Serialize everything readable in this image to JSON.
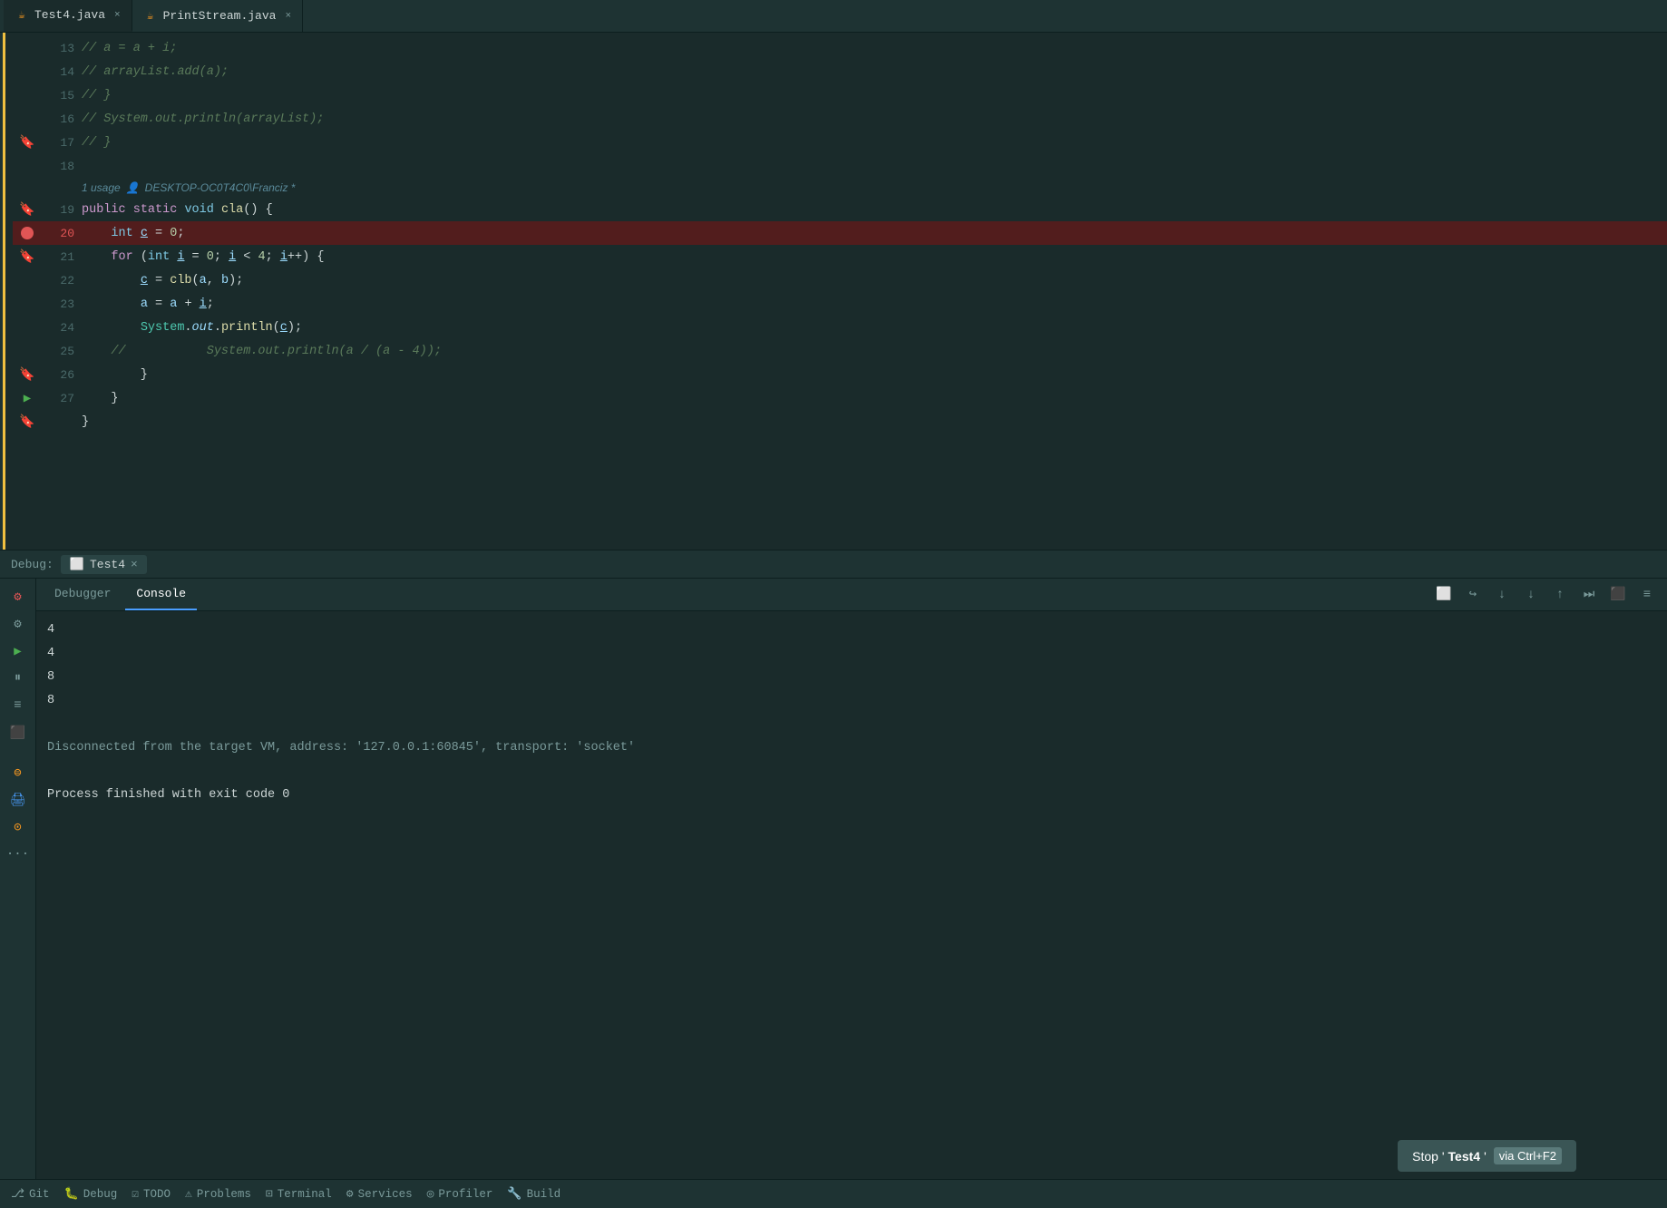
{
  "tabs": [
    {
      "id": "test4",
      "label": "Test4.java",
      "icon": "☕",
      "active": true,
      "closable": true
    },
    {
      "id": "printstream",
      "label": "PrintStream.java",
      "icon": "☕",
      "active": false,
      "closable": true
    }
  ],
  "editor": {
    "lines": [
      {
        "num": 13,
        "content": "//        a = a + i;",
        "type": "comment",
        "gutter": ""
      },
      {
        "num": 14,
        "content": "//        arrayList.add(a);",
        "type": "comment",
        "gutter": ""
      },
      {
        "num": 15,
        "content": "//    }",
        "type": "comment",
        "gutter": ""
      },
      {
        "num": 16,
        "content": "//    System.out.println(arrayList);",
        "type": "comment",
        "gutter": ""
      },
      {
        "num": 17,
        "content": "//    }",
        "type": "comment",
        "gutter": "bookmark"
      },
      {
        "num": 18,
        "content": "",
        "type": "empty",
        "gutter": ""
      },
      {
        "num": 18.5,
        "hint": true,
        "hintText": "1 usage",
        "hintUser": "DESKTOP-OC0T4C0\\Franciz *"
      },
      {
        "num": 19,
        "content": "    public static void cla() {",
        "type": "code",
        "gutter": "bookmark"
      },
      {
        "num": 20,
        "content": "        int c = 0;",
        "type": "code",
        "gutter": "breakpoint",
        "breakpoint": true
      },
      {
        "num": 21,
        "content": "        for (int i = 0; i < 4; i++) {",
        "type": "code",
        "gutter": "bookmark"
      },
      {
        "num": 22,
        "content": "            c = clb(a, b);",
        "type": "code",
        "gutter": ""
      },
      {
        "num": 23,
        "content": "            a = a + i;",
        "type": "code",
        "gutter": ""
      },
      {
        "num": 24,
        "content": "            System.out.println(c);",
        "type": "code",
        "gutter": ""
      },
      {
        "num": 25,
        "content": "//              System.out.println(a / (a - 4));",
        "type": "comment",
        "gutter": ""
      },
      {
        "num": 26,
        "content": "        }",
        "type": "code",
        "gutter": "bookmark"
      },
      {
        "num": 27,
        "content": "        }",
        "type": "code",
        "gutter": "run"
      },
      {
        "num": 27.5,
        "end": true,
        "content": "    }",
        "gutter": "bookmark"
      }
    ]
  },
  "debug_bar": {
    "label": "Debug:",
    "tab_label": "Test4",
    "close": "×"
  },
  "debug_panel": {
    "tabs": [
      {
        "id": "debugger",
        "label": "Debugger",
        "active": false
      },
      {
        "id": "console",
        "label": "Console",
        "active": true
      }
    ],
    "toolbar_buttons": [
      "⬜",
      "↪",
      "↓",
      "↓",
      "↑",
      "⏭",
      "⬛",
      "≡"
    ],
    "console_output": [
      {
        "text": "4",
        "type": "number"
      },
      {
        "text": "4",
        "type": "number"
      },
      {
        "text": "8",
        "type": "number"
      },
      {
        "text": "8",
        "type": "number"
      },
      {
        "text": "",
        "type": "empty"
      },
      {
        "text": "Disconnected from the target VM, address: '127.0.0.1:60845', transport: 'socket'",
        "type": "disconnect"
      },
      {
        "text": "",
        "type": "empty"
      },
      {
        "text": "Process finished with exit code 0",
        "type": "finish"
      }
    ],
    "sidebar_icons": [
      {
        "icon": "⚙",
        "color": "red",
        "label": "debug-icon"
      },
      {
        "icon": "⚙",
        "color": "normal",
        "label": "settings-icon"
      },
      {
        "icon": "▶",
        "color": "green",
        "label": "run-icon"
      },
      {
        "icon": "⏸",
        "color": "normal",
        "label": "pause-icon"
      },
      {
        "icon": "≡",
        "color": "normal",
        "label": "list-icon"
      },
      {
        "icon": "⬛",
        "color": "normal",
        "label": "stop-icon"
      },
      {
        "icon": "⊜",
        "color": "orange",
        "label": "db-icon"
      },
      {
        "icon": "🖨",
        "color": "blue",
        "label": "print-icon"
      },
      {
        "icon": "⊙",
        "color": "orange",
        "label": "circle-icon"
      },
      {
        "icon": "⋯",
        "color": "normal",
        "label": "more-icon"
      }
    ]
  },
  "status_bar": {
    "items": [
      {
        "icon": "⎇",
        "label": "Git",
        "id": "git"
      },
      {
        "icon": "🐛",
        "label": "Debug",
        "id": "debug"
      },
      {
        "icon": "☑",
        "label": "TODO",
        "id": "todo"
      },
      {
        "icon": "⚠",
        "label": "Problems",
        "id": "problems"
      },
      {
        "icon": "⊡",
        "label": "Terminal",
        "id": "terminal"
      },
      {
        "icon": "⚙",
        "label": "Services",
        "id": "services"
      },
      {
        "icon": "◎",
        "label": "Profiler",
        "id": "profiler"
      },
      {
        "icon": "🔧",
        "label": "Build",
        "id": "build"
      }
    ]
  },
  "tooltip": {
    "prefix": "Stop '",
    "name": "Test4",
    "suffix": "'",
    "shortcut": "via Ctrl+F2"
  }
}
